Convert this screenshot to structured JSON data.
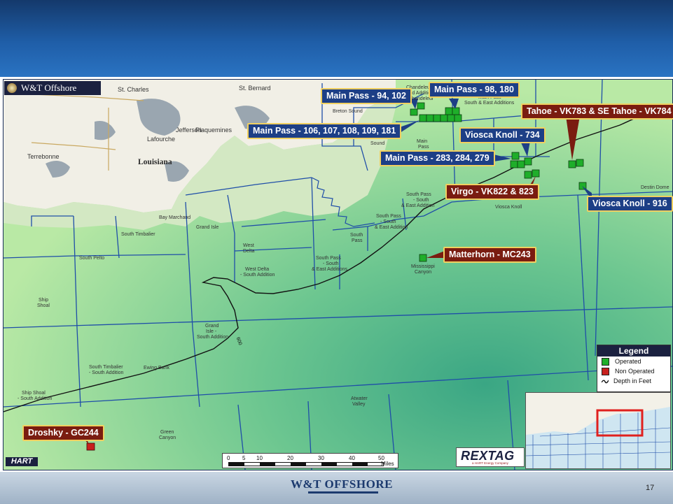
{
  "header": {
    "color_top": "#14396b",
    "color_bottom": "#2a73c2"
  },
  "map": {
    "badge": "W&T Offshore",
    "state_label": "Louisiana",
    "place_labels": [
      {
        "text": "St. Charles",
        "name": "st-charles"
      },
      {
        "text": "St. Bernard",
        "name": "st-bernard"
      },
      {
        "text": "Jefferson",
        "name": "jefferson"
      },
      {
        "text": "Plaquemines",
        "name": "plaquemines"
      },
      {
        "text": "Lafourche",
        "name": "lafourche"
      },
      {
        "text": "Terrebonne",
        "name": "terrebonne"
      },
      {
        "text": "Breton Sound",
        "name": "breton-sound"
      },
      {
        "text": "Sound",
        "name": "sound"
      },
      {
        "text": "Main",
        "name": "main"
      },
      {
        "text": "Pass",
        "name": "pass"
      },
      {
        "text": "Chandeleur",
        "name": "chandeleur"
      },
      {
        "text": "Sound Addition",
        "name": "sound-addition"
      },
      {
        "text": "Chandeleur",
        "name": "chandeleur-2"
      },
      {
        "text": "Main Pass",
        "name": "main-pass-area"
      },
      {
        "text": "South & East Additions",
        "name": "south-east-additions"
      },
      {
        "text": "South Pass",
        "name": "south-pass-a"
      },
      {
        "text": "- South",
        "name": "south-pass-a2"
      },
      {
        "text": "& East Addition",
        "name": "south-pass-a3"
      },
      {
        "text": "South Pass",
        "name": "south-pass-b"
      },
      {
        "text": "- South",
        "name": "south-pass-b2"
      },
      {
        "text": "& East Addition",
        "name": "south-pass-b3"
      },
      {
        "text": "South",
        "name": "south"
      },
      {
        "text": "Pass",
        "name": "pass-2"
      },
      {
        "text": "Viosca Knoll",
        "name": "viosca-knoll-area"
      },
      {
        "text": "Destin Dome",
        "name": "destin-dome"
      },
      {
        "text": "Bay Marchand",
        "name": "bay-marchand"
      },
      {
        "text": "Grand Isle",
        "name": "grand-isle"
      },
      {
        "text": "West",
        "name": "west"
      },
      {
        "text": "Delta",
        "name": "delta"
      },
      {
        "text": "South Timbalier",
        "name": "south-timbalier"
      },
      {
        "text": "South Pelto",
        "name": "south-pelto"
      },
      {
        "text": "West Delta",
        "name": "west-delta-south"
      },
      {
        "text": "- South Addition",
        "name": "west-delta-south2"
      },
      {
        "text": "South Pass",
        "name": "south-pass-c"
      },
      {
        "text": "- South",
        "name": "south-pass-c2"
      },
      {
        "text": "& East Additions",
        "name": "south-pass-c3"
      },
      {
        "text": "Mississippi",
        "name": "mississippi"
      },
      {
        "text": "Canyon",
        "name": "canyon"
      },
      {
        "text": "Ship",
        "name": "ship"
      },
      {
        "text": "Shoal",
        "name": "shoal"
      },
      {
        "text": "Grand",
        "name": "grand"
      },
      {
        "text": "Isle -",
        "name": "isle"
      },
      {
        "text": "South Addition",
        "name": "gi-south-addition"
      },
      {
        "text": "South Timbalier",
        "name": "st-south-addition"
      },
      {
        "text": "- South Addition",
        "name": "st-south-addition2"
      },
      {
        "text": "Ewing Bank",
        "name": "ewing-bank"
      },
      {
        "text": "Ship Shoal",
        "name": "ship-shoal-2"
      },
      {
        "text": "- South Addition",
        "name": "ship-shoal-2b"
      },
      {
        "text": "Atwater",
        "name": "atwater"
      },
      {
        "text": "Valley",
        "name": "valley"
      },
      {
        "text": "Green",
        "name": "green"
      },
      {
        "text": "Canyon",
        "name": "canyon-2"
      }
    ],
    "depth_label": "600"
  },
  "callouts": [
    {
      "name": "callout-main-pass-94-102",
      "text": "Main Pass - 94, 102",
      "style": "blue"
    },
    {
      "name": "callout-main-pass-98-180",
      "text": "Main Pass - 98, 180",
      "style": "blue"
    },
    {
      "name": "callout-tahoe",
      "text": "Tahoe - VK783 & SE Tahoe - VK784",
      "style": "red"
    },
    {
      "name": "callout-main-pass-106",
      "text": "Main Pass - 106, 107, 108, 109, 181",
      "style": "blue"
    },
    {
      "name": "callout-viosca-knoll-734",
      "text": "Viosca Knoll - 734",
      "style": "blue"
    },
    {
      "name": "callout-main-pass-283",
      "text": "Main Pass - 283, 284, 279",
      "style": "blue"
    },
    {
      "name": "callout-virgo",
      "text": "Virgo - VK822 & 823",
      "style": "red"
    },
    {
      "name": "callout-viosca-knoll-916",
      "text": "Viosca Knoll - 916",
      "style": "blue"
    },
    {
      "name": "callout-matterhorn",
      "text": "Matterhorn - MC243",
      "style": "red"
    },
    {
      "name": "callout-droshky",
      "text": "Droshky - GC244",
      "style": "red"
    }
  ],
  "legend": {
    "title": "Legend",
    "items": [
      {
        "label": "Operated",
        "color": "#1fae2a"
      },
      {
        "label": "Non Operated",
        "color": "#c8201e"
      },
      {
        "label": "Depth in Feet",
        "color": "#111111"
      }
    ]
  },
  "scale": {
    "ticks": [
      "0",
      "5",
      "10",
      "20",
      "30",
      "40",
      "50"
    ],
    "unit": "Miles"
  },
  "brand": {
    "rextag": "REXTAG",
    "rextag_sub": "a HART Energy Company",
    "hart": "HART"
  },
  "footer": {
    "logo": "W&T OFFSHORE",
    "page": "17"
  }
}
